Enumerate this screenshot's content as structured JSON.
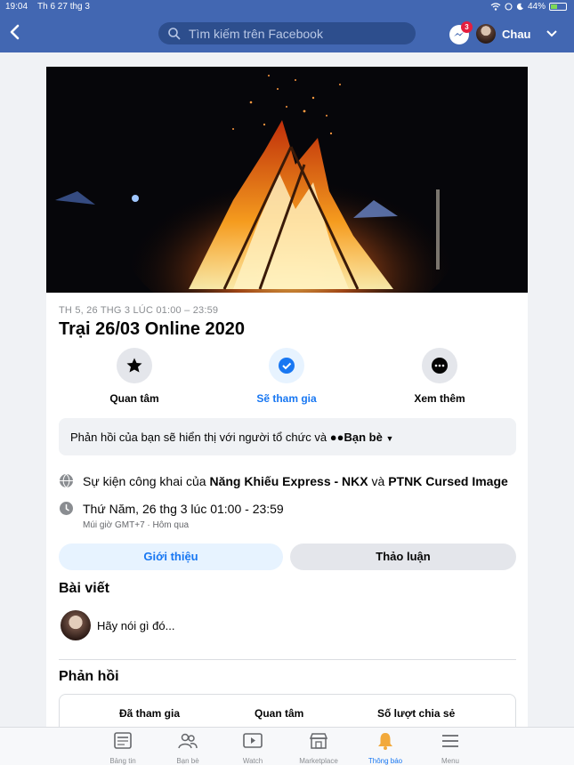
{
  "status_bar": {
    "time": "19:04",
    "date": "Th 6 27 thg 3",
    "battery": "44%",
    "battery_level": 0.44
  },
  "header": {
    "search_placeholder": "Tìm kiếm trên Facebook",
    "messenger_badge": "3",
    "user_name": "Chau"
  },
  "event": {
    "date_line": "TH 5, 26 THG 3 LÚC 01:00 – 23:59",
    "title": "Trại 26/03 Online 2020",
    "actions": [
      {
        "label": "Quan tâm",
        "icon": "star-icon"
      },
      {
        "label": "Sẽ tham gia",
        "icon": "check-circle-icon"
      },
      {
        "label": "Xem thêm",
        "icon": "more-icon"
      }
    ],
    "notice": {
      "text": "Phản hồi của bạn sẽ hiển thị với người tổ chức và",
      "audience": "Bạn bè"
    },
    "public_event": {
      "prefix": "Sự kiện công khai của",
      "host1": "Năng Khiếu Express - NKX",
      "joiner": "và",
      "host2": "PTNK Cursed Image"
    },
    "time": {
      "text": "Thứ Năm, 26 thg 3 lúc 01:00 - 23:59",
      "sub": "Múi giờ GMT+7 · Hôm qua"
    },
    "tabs": {
      "about": "Giới thiệu",
      "discussion": "Thảo luận"
    }
  },
  "posts": {
    "heading": "Bài viết",
    "composer_placeholder": "Hãy nói gì đó..."
  },
  "responses": {
    "heading": "Phản hồi",
    "stats": [
      "Đã tham gia",
      "Quan tâm",
      "Số lượt chia sẻ"
    ]
  },
  "bottom_nav": [
    {
      "label": "Bảng tin",
      "icon": "news-feed-icon"
    },
    {
      "label": "Bạn bè",
      "icon": "friends-icon"
    },
    {
      "label": "Watch",
      "icon": "watch-icon"
    },
    {
      "label": "Marketplace",
      "icon": "marketplace-icon"
    },
    {
      "label": "Thông báo",
      "icon": "bell-icon",
      "active": true
    },
    {
      "label": "Menu",
      "icon": "menu-icon"
    }
  ],
  "colors": {
    "header": "#4267b2",
    "accent": "#1877f2",
    "badge": "#e41e3f"
  }
}
